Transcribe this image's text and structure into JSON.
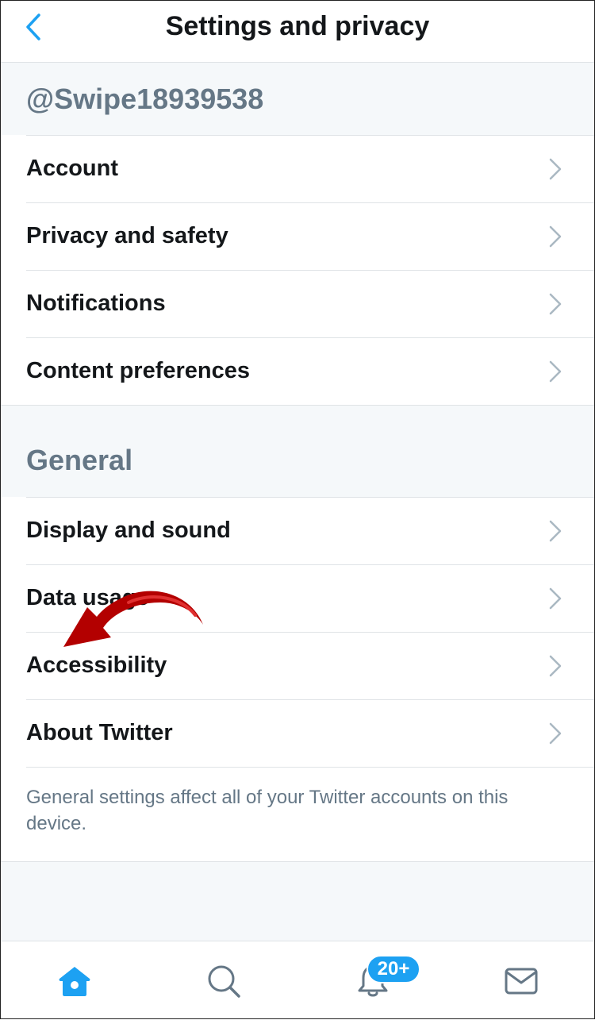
{
  "header": {
    "title": "Settings and privacy",
    "back_icon": "chevron-left-icon"
  },
  "account_section": {
    "handle": "@Swipe18939538",
    "items": [
      {
        "label": "Account"
      },
      {
        "label": "Privacy and safety"
      },
      {
        "label": "Notifications"
      },
      {
        "label": "Content preferences"
      }
    ]
  },
  "general_section": {
    "title": "General",
    "items": [
      {
        "label": "Display and sound"
      },
      {
        "label": "Data usage"
      },
      {
        "label": "Accessibility"
      },
      {
        "label": "About Twitter"
      }
    ],
    "note": "General settings affect all of your Twitter accounts on this device."
  },
  "tabbar": {
    "tabs": [
      {
        "icon": "home-icon",
        "active": true
      },
      {
        "icon": "search-icon",
        "active": false
      },
      {
        "icon": "bell-icon",
        "active": false,
        "badge": "20+"
      },
      {
        "icon": "mail-icon",
        "active": false
      }
    ]
  },
  "colors": {
    "accent": "#1da1f2",
    "text": "#14171a",
    "secondary": "#657786",
    "section_bg": "#f5f8fa",
    "annotation": "#c00000"
  }
}
